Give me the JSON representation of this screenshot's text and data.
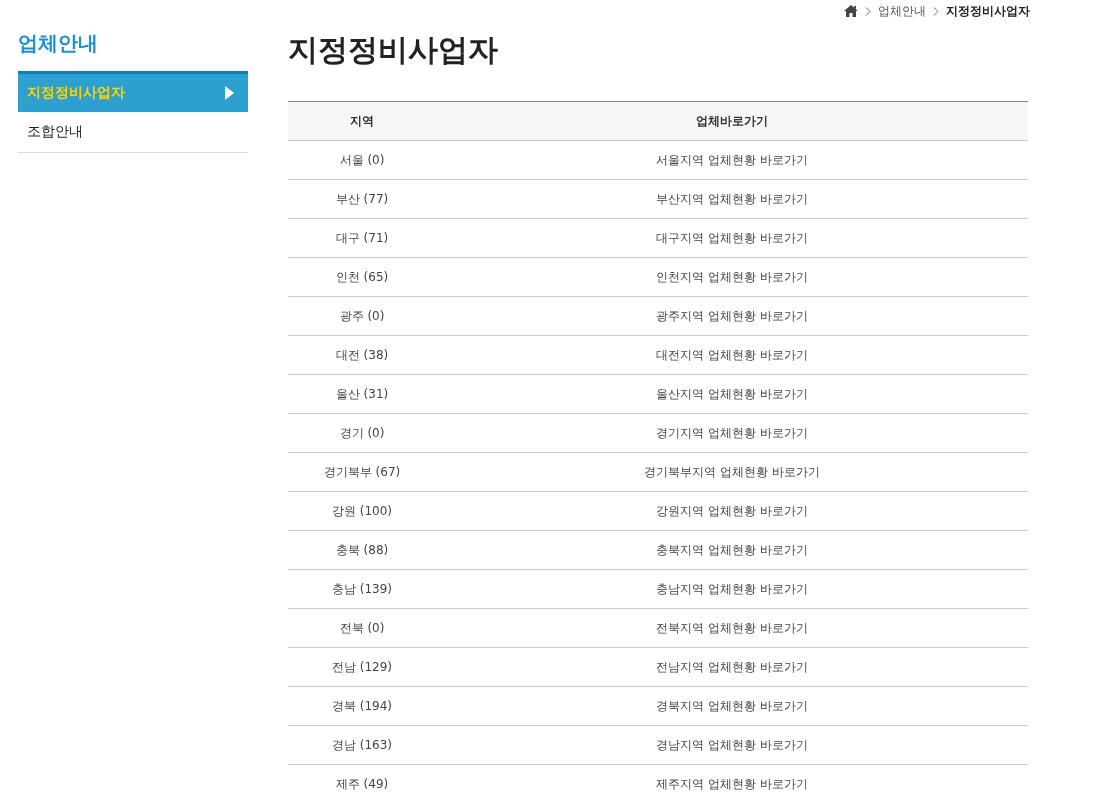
{
  "breadcrumb": [
    "업체안내",
    "지정정비사업자"
  ],
  "sidebar": {
    "title": "업체안내",
    "items": [
      {
        "label": "지정정비사업자",
        "selected": true
      },
      {
        "label": "조합안내",
        "selected": false
      }
    ]
  },
  "page_title": "지정정비사업자",
  "table": {
    "columns": [
      "지역",
      "업체바로가기"
    ],
    "rows": [
      {
        "region": "서울 (0)",
        "link": "서울지역 업체현황 바로가기"
      },
      {
        "region": "부산 (77)",
        "link": "부산지역 업체현황 바로가기"
      },
      {
        "region": "대구 (71)",
        "link": "대구지역 업체현황 바로가기"
      },
      {
        "region": "인천 (65)",
        "link": "인천지역 업체현황 바로가기"
      },
      {
        "region": "광주 (0)",
        "link": "광주지역 업체현황 바로가기"
      },
      {
        "region": "대전 (38)",
        "link": "대전지역 업체현황 바로가기"
      },
      {
        "region": "울산 (31)",
        "link": "울산지역 업체현황 바로가기"
      },
      {
        "region": "경기 (0)",
        "link": "경기지역 업체현황 바로가기"
      },
      {
        "region": "경기북부 (67)",
        "link": "경기북부지역 업체현황 바로가기"
      },
      {
        "region": "강원 (100)",
        "link": "강원지역 업체현황 바로가기"
      },
      {
        "region": "충북 (88)",
        "link": "충북지역 업체현황 바로가기"
      },
      {
        "region": "충남 (139)",
        "link": "충남지역 업체현황 바로가기"
      },
      {
        "region": "전북 (0)",
        "link": "전북지역 업체현황 바로가기"
      },
      {
        "region": "전남 (129)",
        "link": "전남지역 업체현황 바로가기"
      },
      {
        "region": "경북 (194)",
        "link": "경북지역 업체현황 바로가기"
      },
      {
        "region": "경남 (163)",
        "link": "경남지역 업체현황 바로가기"
      },
      {
        "region": "제주 (49)",
        "link": "제주지역 업체현황 바로가기"
      }
    ]
  }
}
